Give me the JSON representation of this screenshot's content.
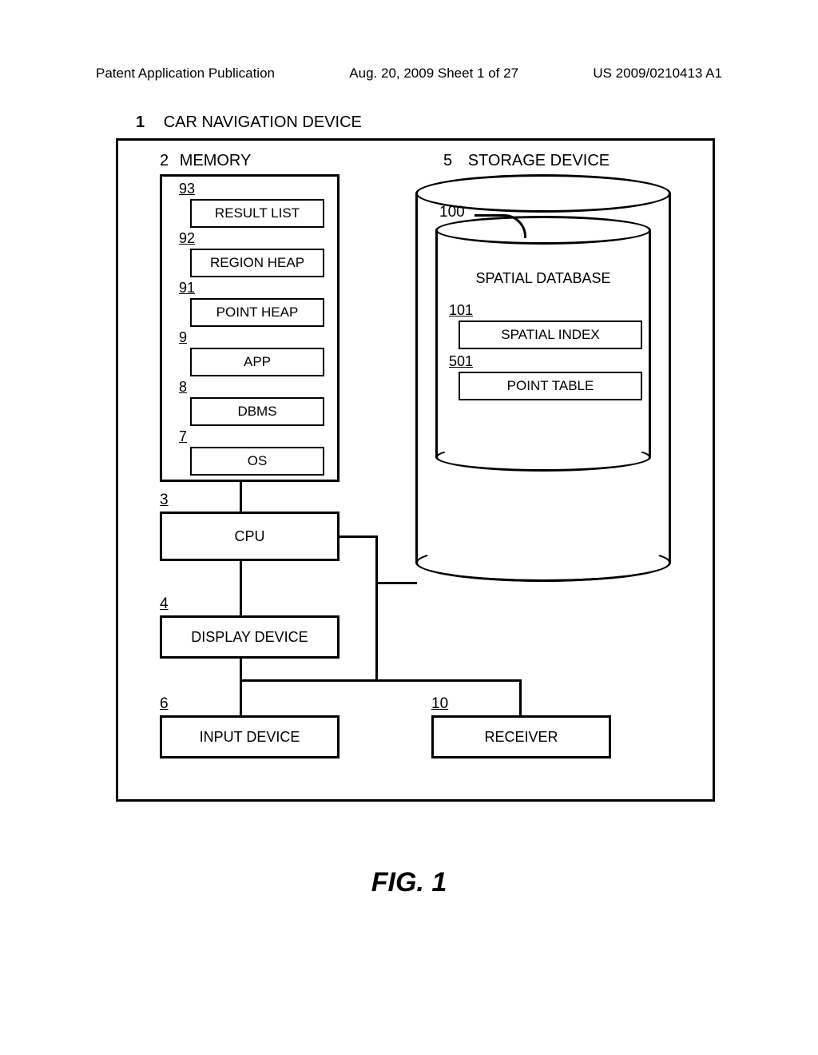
{
  "header": {
    "left": "Patent Application Publication",
    "mid": "Aug. 20, 2009  Sheet 1 of 27",
    "right": "US 2009/0210413 A1"
  },
  "title": {
    "num": "1",
    "text": "CAR NAVIGATION DEVICE"
  },
  "memory": {
    "num": "2",
    "label": "MEMORY",
    "items": [
      {
        "num": "93",
        "label": "RESULT LIST"
      },
      {
        "num": "92",
        "label": "REGION HEAP"
      },
      {
        "num": "91",
        "label": "POINT HEAP"
      },
      {
        "num": "9",
        "label": "APP"
      },
      {
        "num": "8",
        "label": "DBMS"
      },
      {
        "num": "7",
        "label": "OS"
      }
    ]
  },
  "storage": {
    "num": "5",
    "label": "STORAGE DEVICE"
  },
  "database": {
    "num": "100",
    "label": "SPATIAL DATABASE",
    "subs": [
      {
        "num": "101",
        "label": "SPATIAL INDEX"
      },
      {
        "num": "501",
        "label": "POINT TABLE"
      }
    ]
  },
  "blocks": {
    "cpu": {
      "num": "3",
      "label": "CPU"
    },
    "display": {
      "num": "4",
      "label": "DISPLAY DEVICE"
    },
    "input": {
      "num": "6",
      "label": "INPUT DEVICE"
    },
    "receiver": {
      "num": "10",
      "label": "RECEIVER"
    }
  },
  "figure": "FIG. 1"
}
